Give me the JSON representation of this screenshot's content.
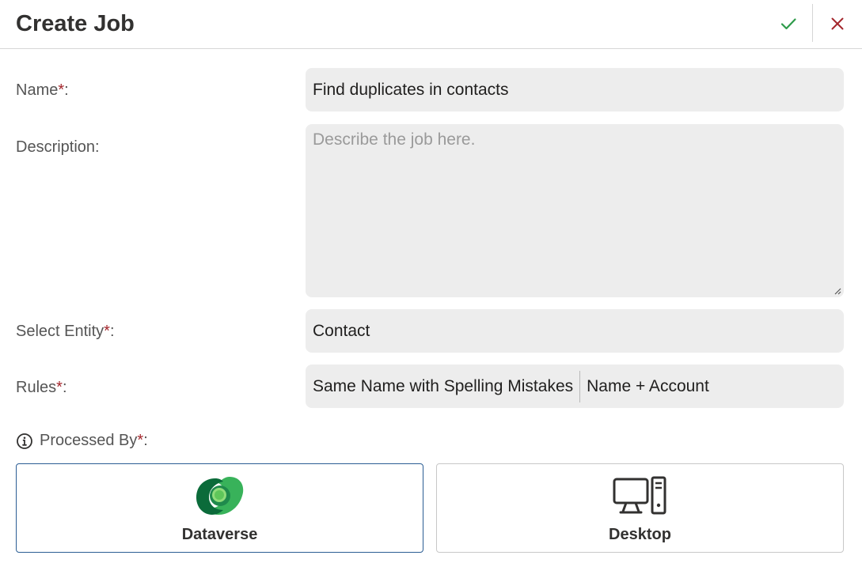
{
  "dialog": {
    "title": "Create Job",
    "ok_icon": "checkmark-icon",
    "close_icon": "close-icon"
  },
  "form": {
    "name": {
      "label": "Name",
      "required_mark": "*",
      "suffix": ":",
      "value": "Find duplicates in contacts"
    },
    "description": {
      "label": "Description:",
      "value": "",
      "placeholder": "Describe the job here."
    },
    "entity": {
      "label": "Select Entity",
      "required_mark": "*",
      "suffix": ":",
      "value": "Contact"
    },
    "rules": {
      "label": "Rules",
      "required_mark": "*",
      "suffix": ":",
      "items": [
        "Same Name with Spelling Mistakes",
        "Name + Account"
      ]
    },
    "processed_by": {
      "label": "Processed By",
      "required_mark": "*",
      "suffix": ":",
      "info_icon": "info-icon",
      "options": [
        {
          "label": "Dataverse",
          "icon": "dataverse-logo-icon",
          "selected": true
        },
        {
          "label": "Desktop",
          "icon": "desktop-computer-icon",
          "selected": false
        }
      ]
    }
  },
  "colors": {
    "accent_border": "#2b5d94",
    "ok_green": "#2e9b4a",
    "close_red": "#a4262c",
    "field_bg": "#ededed"
  }
}
